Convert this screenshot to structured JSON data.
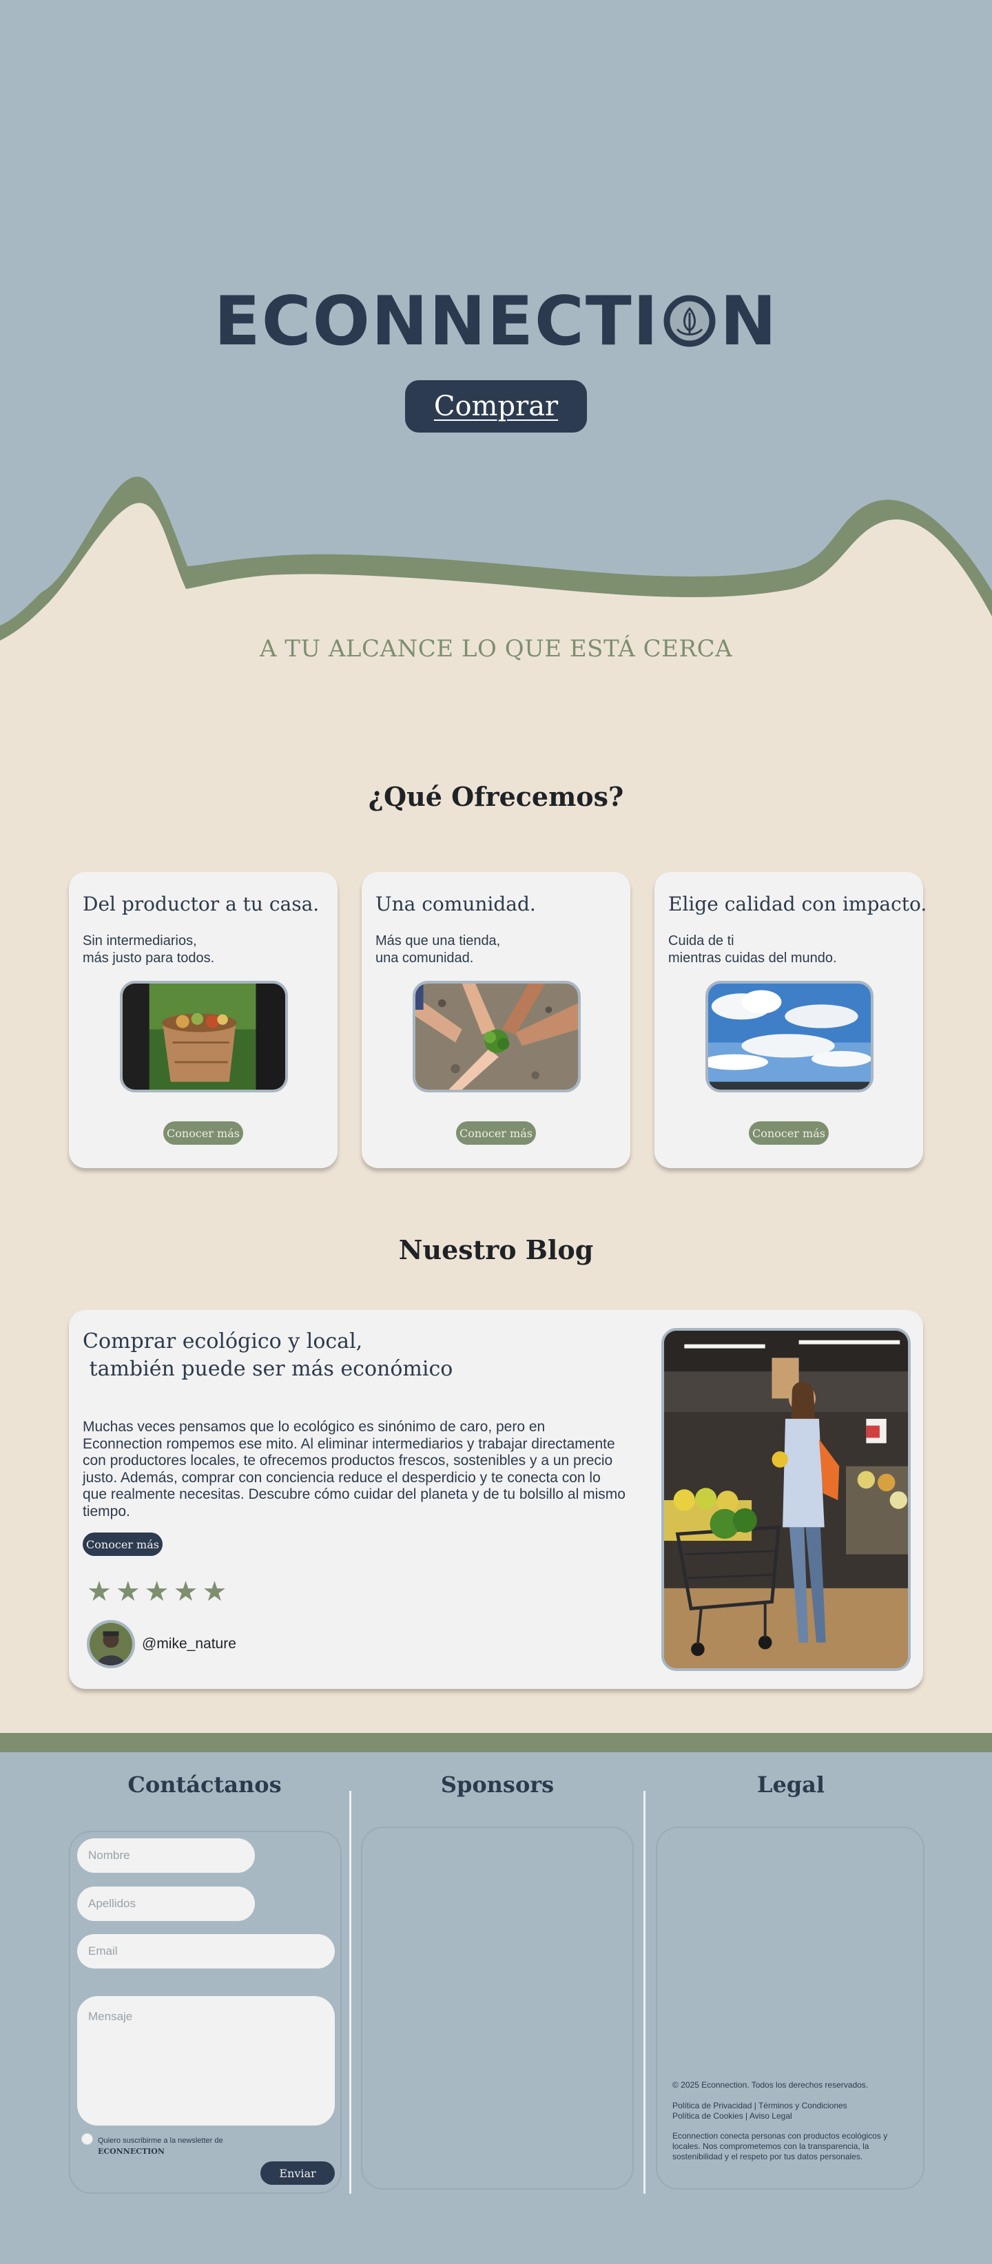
{
  "hero": {
    "brand_before": "ECONNECTI",
    "brand_after": "N",
    "logo_icon": "leaf-in-circle-icon",
    "buy_label": "Comprar",
    "tagline": "A TU ALCANCE LO QUE ESTÁ CERCA"
  },
  "offer": {
    "title": "¿Qué Ofrecemos?",
    "cards": [
      {
        "title": "Del productor a tu casa.",
        "desc_line1": "Sin intermediarios,",
        "desc_line2": "más justo para todos.",
        "button": "Conocer más"
      },
      {
        "title": "Una comunidad.",
        "desc_line1": "Más que una tienda,",
        "desc_line2": "una comunidad.",
        "button": "Conocer más"
      },
      {
        "title": "Elige calidad con impacto.",
        "desc_line1": "Cuida de ti",
        "desc_line2": "mientras cuidas del mundo.",
        "button": "Conocer más"
      }
    ]
  },
  "blog": {
    "title": "Nuestro Blog",
    "post": {
      "heading_line1": "Comprar ecológico y local,",
      "heading_line2": " también puede ser más económico",
      "body": "Muchas veces pensamos que lo ecológico es sinónimo de caro, pero en Econnection rompemos ese mito. Al eliminar intermediarios y trabajar directamente con productores locales, te ofrecemos productos frescos, sostenibles y a un precio justo. Además, comprar con conciencia reduce el desperdicio y te conecta con lo que realmente necesitas. Descubre cómo cuidar del planeta y de tu bolsillo al mismo tiempo.",
      "button": "Conocer más",
      "stars": "★★★★★",
      "rating": 5,
      "author": "@mike_nature"
    }
  },
  "footer": {
    "contact_title": "Contáctanos",
    "sponsors_title": "Sponsors",
    "legal_title": "Legal",
    "form": {
      "name_placeholder": "Nombre",
      "surname_placeholder": "Apellidos",
      "email_placeholder": "Email",
      "message_placeholder": "Mensaje",
      "newsletter_label": "Quiero suscribirme a la newsletter de",
      "newsletter_brand": "ECONNECTION",
      "send_label": "Enviar"
    },
    "legal": {
      "copyright": "© 2025 Econnection. Todos los derechos reservados.",
      "links_line1": "Política de Privacidad | Términos y Condiciones",
      "links_line2": "Política de Cookies | Aviso Legal",
      "about_line1": "Econnection conecta personas con productos ecológicos y",
      "about_line2": "locales. Nos comprometemos con la transparencia, la",
      "about_line3": "sostenibilidad y el respeto por tus datos personales."
    }
  },
  "colors": {
    "hero_bg": "#a8b8c2",
    "cream": "#ede3d5",
    "green": "#7d8f6f",
    "navy": "#2d3b50",
    "card_bg": "#f2f2f2"
  }
}
